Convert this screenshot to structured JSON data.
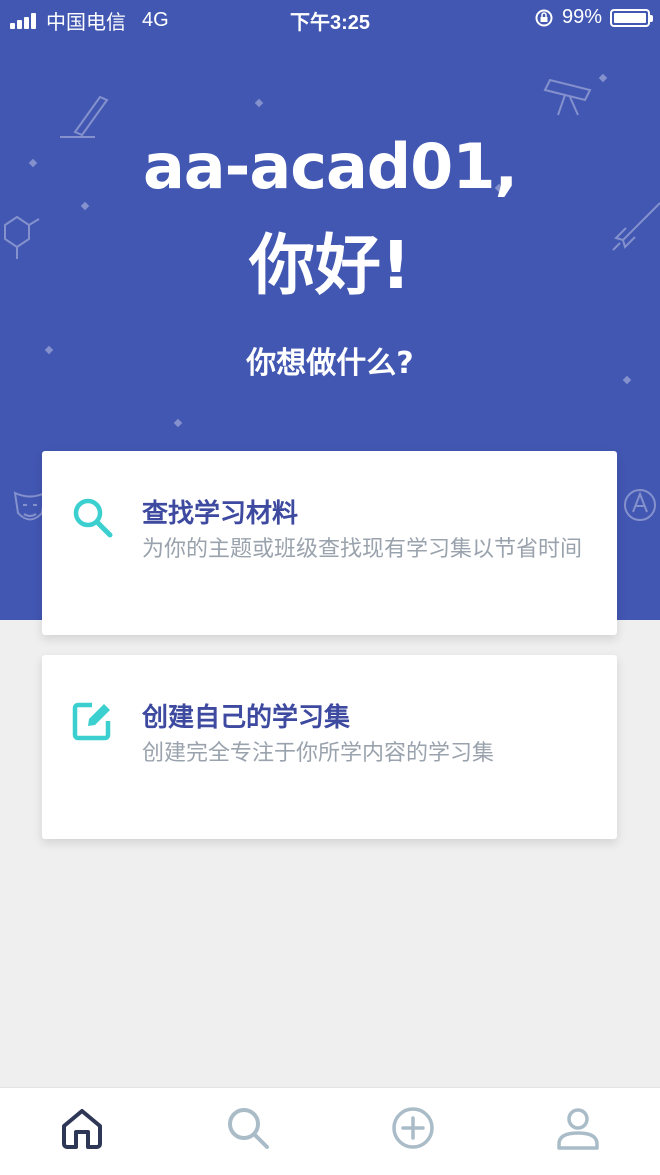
{
  "status_bar": {
    "carrier": "中国电信",
    "network": "4G",
    "time": "下午3:25",
    "battery_label": "99%",
    "battery_level": 0.99
  },
  "greeting": {
    "name_line": "aa-acad01,",
    "hello_line": "你好!",
    "question": "你想做什么?"
  },
  "cards": [
    {
      "title": "查找学习材料",
      "description": "为你的主题或班级查找现有学习集以节省时间",
      "icon": "search-icon"
    },
    {
      "title": "创建自己的学习集",
      "description": "创建完全专注于你所学内容的学习集",
      "icon": "edit-icon"
    }
  ],
  "tabbar": {
    "tabs": [
      {
        "icon": "home-icon",
        "active": true
      },
      {
        "icon": "search-icon",
        "active": false
      },
      {
        "icon": "add-icon",
        "active": false
      },
      {
        "icon": "profile-icon",
        "active": false
      }
    ]
  },
  "colors": {
    "hero_background": "#4257b2",
    "page_background": "#efefef",
    "card_title": "#3d4aa0",
    "card_description": "#9aa3ad",
    "icon_accent": "#3ccfcf",
    "tab_inactive": "#a9bcc8",
    "tab_active": "#2e3856"
  }
}
